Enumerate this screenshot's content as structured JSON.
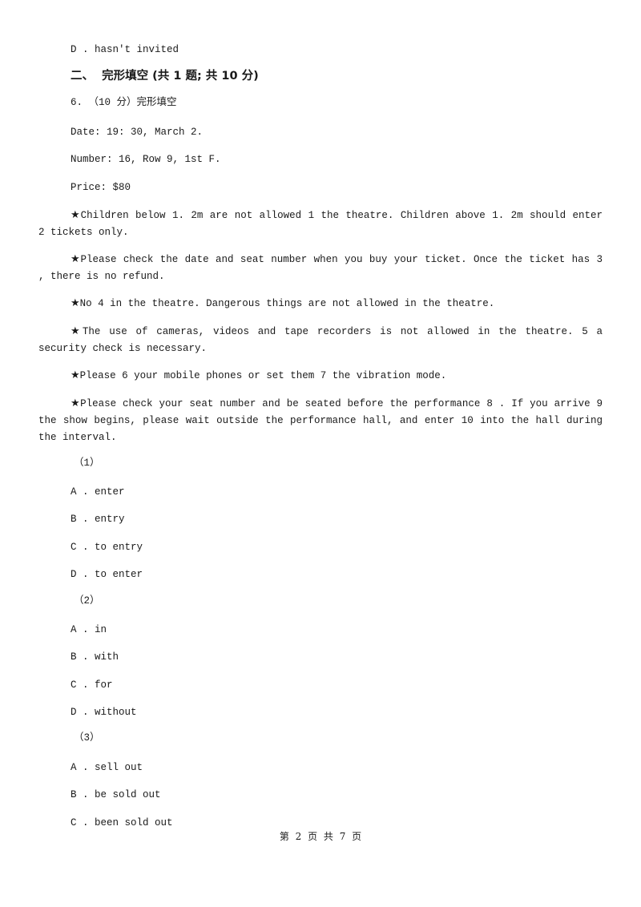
{
  "prev_option": "D . hasn't invited",
  "section_heading": "二、  完形填空 (共 1 题; 共 10 分)",
  "question": {
    "title": "6. （10 分）完形填空",
    "ticket_info": [
      "Date: 19: 30, March 2.",
      "Number: 16, Row 9, 1st F.",
      "Price: $80"
    ],
    "paragraphs": [
      {
        "star": "★",
        "text": "Children below 1. 2m are not allowed    1     the theatre. Children above   1. 2m should enter    2    tickets only."
      },
      {
        "star": "★",
        "text": "Please check the date and seat number when you buy your ticket. Once the ticket has    3   , there is no refund."
      },
      {
        "star": "★",
        "text": "No    4    in the theatre. Dangerous things are not allowed in the theatre."
      },
      {
        "star": "★",
        "text": "The use of cameras, videos and tape recorders is not allowed in the theatre.   5    a security check is necessary."
      },
      {
        "star": "★",
        "text": "Please    6     your mobile phones or set them    7 the vibration mode."
      },
      {
        "star": "★",
        "text": "Please check your seat number and be seated before the performance   8   . If you arrive   9   the show begins, please wait outside the performance hall, and enter    10   into the hall during the interval."
      }
    ],
    "sub_questions": [
      {
        "label": "（1）",
        "options": [
          "A . enter",
          "B . entry",
          "C . to entry",
          "D . to enter"
        ]
      },
      {
        "label": "（2）",
        "options": [
          "A . in",
          "B . with",
          "C . for",
          "D . without"
        ]
      },
      {
        "label": "（3）",
        "options": [
          "A . sell out",
          "B . be sold out",
          "C . been sold out"
        ]
      }
    ]
  },
  "footer": "第 2 页 共 7 页"
}
